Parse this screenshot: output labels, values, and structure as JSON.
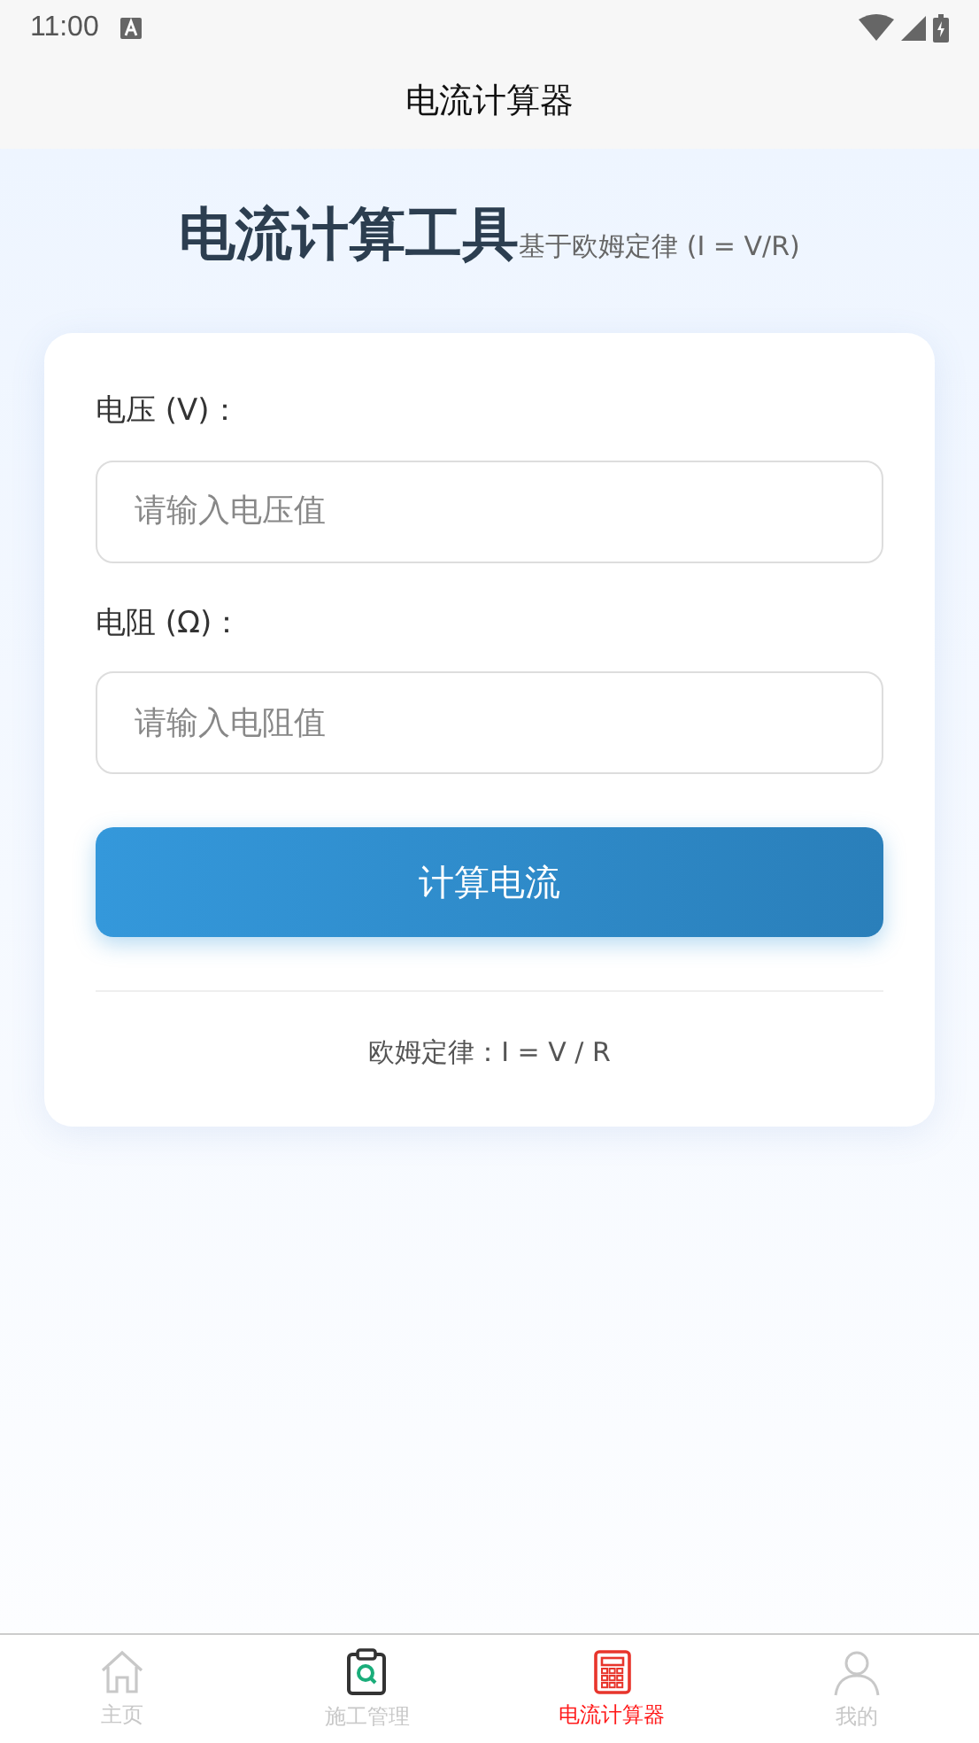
{
  "status_bar": {
    "time": "11:00"
  },
  "app_bar": {
    "title": "电流计算器"
  },
  "header": {
    "title": "电流计算工具",
    "subtitle": "基于欧姆定律 (I = V/R)"
  },
  "form": {
    "fields": [
      {
        "label": "电压 (V)：",
        "placeholder": "请输入电压值"
      },
      {
        "label": "电阻 (Ω)：",
        "placeholder": "请输入电阻值"
      }
    ],
    "button": "计算电流",
    "formula": "欧姆定律：I = V / R"
  },
  "tab_bar": [
    {
      "kind": "home",
      "label": "主页",
      "selected": false
    },
    {
      "kind": "clipboard",
      "label": "施工管理",
      "selected": false
    },
    {
      "kind": "calculator",
      "label": "电流计算器",
      "selected": true
    },
    {
      "kind": "person",
      "label": "我的",
      "selected": false
    }
  ]
}
